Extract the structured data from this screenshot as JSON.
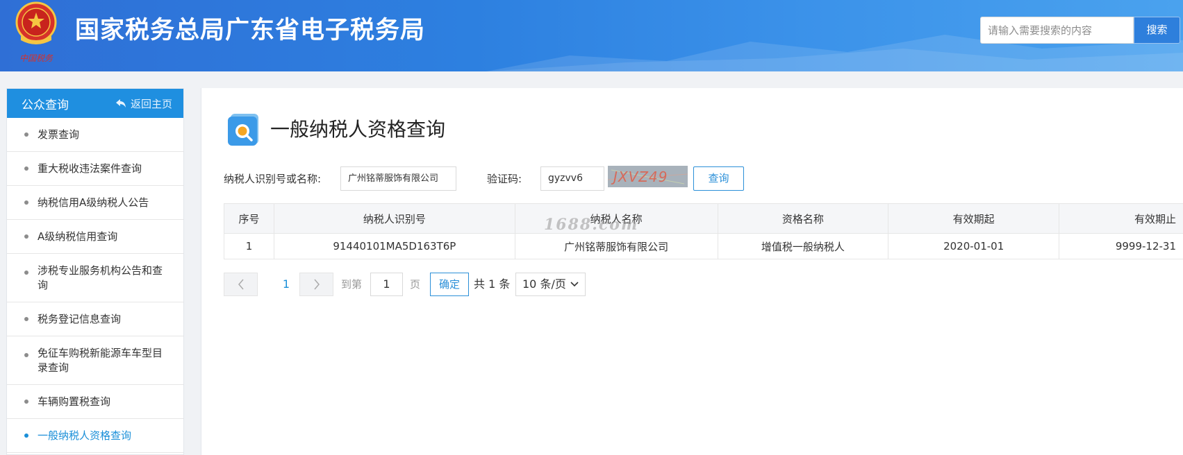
{
  "header": {
    "site_title": "国家税务总局广东省电子税务局",
    "search_placeholder": "请输入需要搜索的内容",
    "search_button": "搜索",
    "brand_color": "#2d80e0"
  },
  "sidebar": {
    "title": "公众查询",
    "back_label": "返回主页",
    "items": [
      {
        "label": "发票查询"
      },
      {
        "label": "重大税收违法案件查询"
      },
      {
        "label": "纳税信用A级纳税人公告"
      },
      {
        "label": "A级纳税信用查询"
      },
      {
        "label": "涉税专业服务机构公告和查询"
      },
      {
        "label": "税务登记信息查询"
      },
      {
        "label": "免征车购税新能源车车型目录查询"
      },
      {
        "label": "车辆购置税查询"
      },
      {
        "label": "一般纳税人资格查询",
        "active": true
      }
    ]
  },
  "main": {
    "page_title": "一般纳税人资格查询",
    "form": {
      "taxpayer_label": "纳税人识别号或名称:",
      "taxpayer_value": "广州铭蒂服饰有限公司",
      "captcha_label": "验证码:",
      "captcha_value": "gyzvv6",
      "captcha_image_text": "JXVZ49",
      "query_button": "查询"
    },
    "table": {
      "headers": [
        "序号",
        "纳税人识别号",
        "纳税人名称",
        "资格名称",
        "有效期起",
        "有效期止"
      ],
      "rows": [
        [
          "1",
          "91440101MA5D163T6P",
          "广州铭蒂服饰有限公司",
          "增值税一般纳税人",
          "2020-01-01",
          "9999-12-31"
        ]
      ]
    },
    "watermark": "1688.com",
    "pagination": {
      "current_page": "1",
      "goto_label": "到第",
      "goto_value": "1",
      "page_unit": "页",
      "confirm_button": "确定",
      "total": "共 1 条",
      "page_size": "10 条/页"
    }
  }
}
